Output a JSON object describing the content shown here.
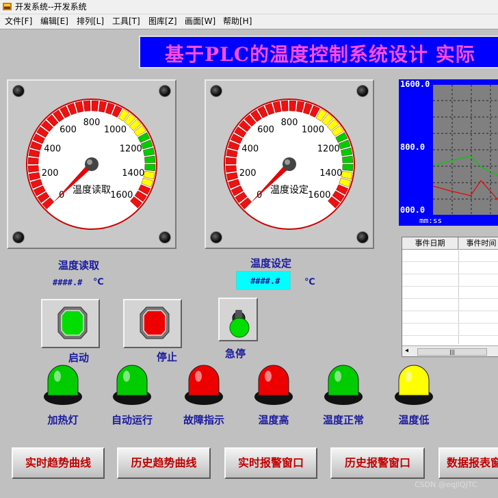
{
  "window": {
    "title": "开发系统--开发系统"
  },
  "menu": [
    "文件[F]",
    "编辑[E]",
    "排列[L]",
    "工具[T]",
    "图库[Z]",
    "画面[W]",
    "帮助[H]"
  ],
  "banner": {
    "text": "基于PLC的温度控制系统设计 实际"
  },
  "gauges": [
    {
      "ticks": [
        "0",
        "200",
        "400",
        "600",
        "800",
        "1000",
        "1200",
        "1400",
        "1600"
      ],
      "caption": "温度读取",
      "needle_value": 0
    },
    {
      "ticks": [
        "0",
        "200",
        "400",
        "600",
        "800",
        "1000",
        "1200",
        "1400",
        "1600"
      ],
      "caption": "温度设定",
      "needle_value": 0
    }
  ],
  "readout": {
    "label": "温度读取",
    "value": "####.#",
    "unit": "℃"
  },
  "setpoint": {
    "label": "温度设定",
    "value": "####.#",
    "unit": "℃"
  },
  "buttons": {
    "start": "启动",
    "stop": "停止",
    "estop": "急停"
  },
  "lamps": [
    {
      "label": "加热灯",
      "color": "#00cc00"
    },
    {
      "label": "自动运行",
      "color": "#00cc00"
    },
    {
      "label": "故障指示",
      "color": "#ee0000"
    },
    {
      "label": "温度高",
      "color": "#ee0000"
    },
    {
      "label": "温度正常",
      "color": "#00cc00"
    },
    {
      "label": "温度低",
      "color": "#ffff00"
    }
  ],
  "nav": [
    "实时趋势曲线",
    "历史趋势曲线",
    "实时报警窗口",
    "历史报警窗口",
    "数据报表窗"
  ],
  "trend": {
    "y_ticks": [
      "1600.0",
      "800.0",
      "000.0"
    ],
    "x_label": "mm:ss"
  },
  "events": {
    "headers": [
      "事件日期",
      "事件时间"
    ]
  },
  "watermark": "CSDN @eqJlQJTC",
  "colors": {
    "banner_bg": "#0000ff",
    "banner_text": "#ff4de0",
    "label": "#1a1aa0",
    "nav_text": "#c00000"
  }
}
